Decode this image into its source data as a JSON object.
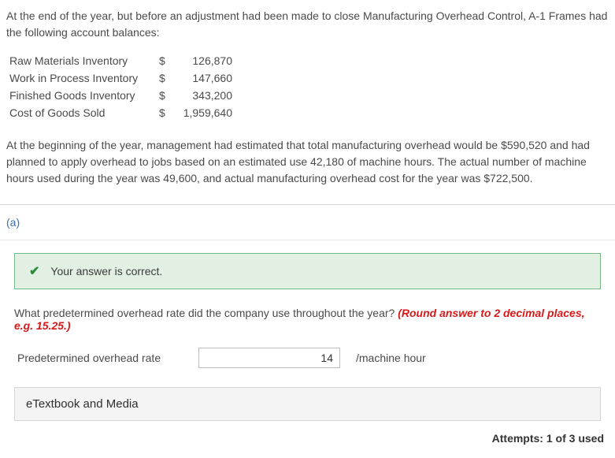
{
  "intro": "At the end of the year, but before an adjustment had been made to close Manufacturing Overhead Control, A-1 Frames had the following account balances:",
  "balances": [
    {
      "label": "Raw Materials Inventory",
      "currency": "$",
      "amount": "126,870"
    },
    {
      "label": "Work in Process Inventory",
      "currency": "$",
      "amount": "147,660"
    },
    {
      "label": "Finished Goods Inventory",
      "currency": "$",
      "amount": "343,200"
    },
    {
      "label": "Cost of Goods Sold",
      "currency": "$",
      "amount": "1,959,640"
    }
  ],
  "narrative": "At the beginning of the year, management had estimated that total manufacturing overhead would be $590,520 and had planned to apply overhead to jobs based on an estimated use 42,180 of machine hours. The actual number of machine hours used during the year was 49,600, and actual manufacturing overhead cost for the year was $722,500.",
  "section": {
    "label": "(a)"
  },
  "banner": {
    "message": "Your answer is correct."
  },
  "question": {
    "text": "What predetermined overhead rate did the company use throughout the year? ",
    "instruction": "(Round answer to 2 decimal places, e.g. 15.25.)"
  },
  "rate": {
    "label": "Predetermined overhead rate",
    "value": "14",
    "unit": "/machine hour"
  },
  "etextbook": {
    "label": "eTextbook and Media"
  },
  "attempts": {
    "text": "Attempts: 1 of 3 used"
  }
}
